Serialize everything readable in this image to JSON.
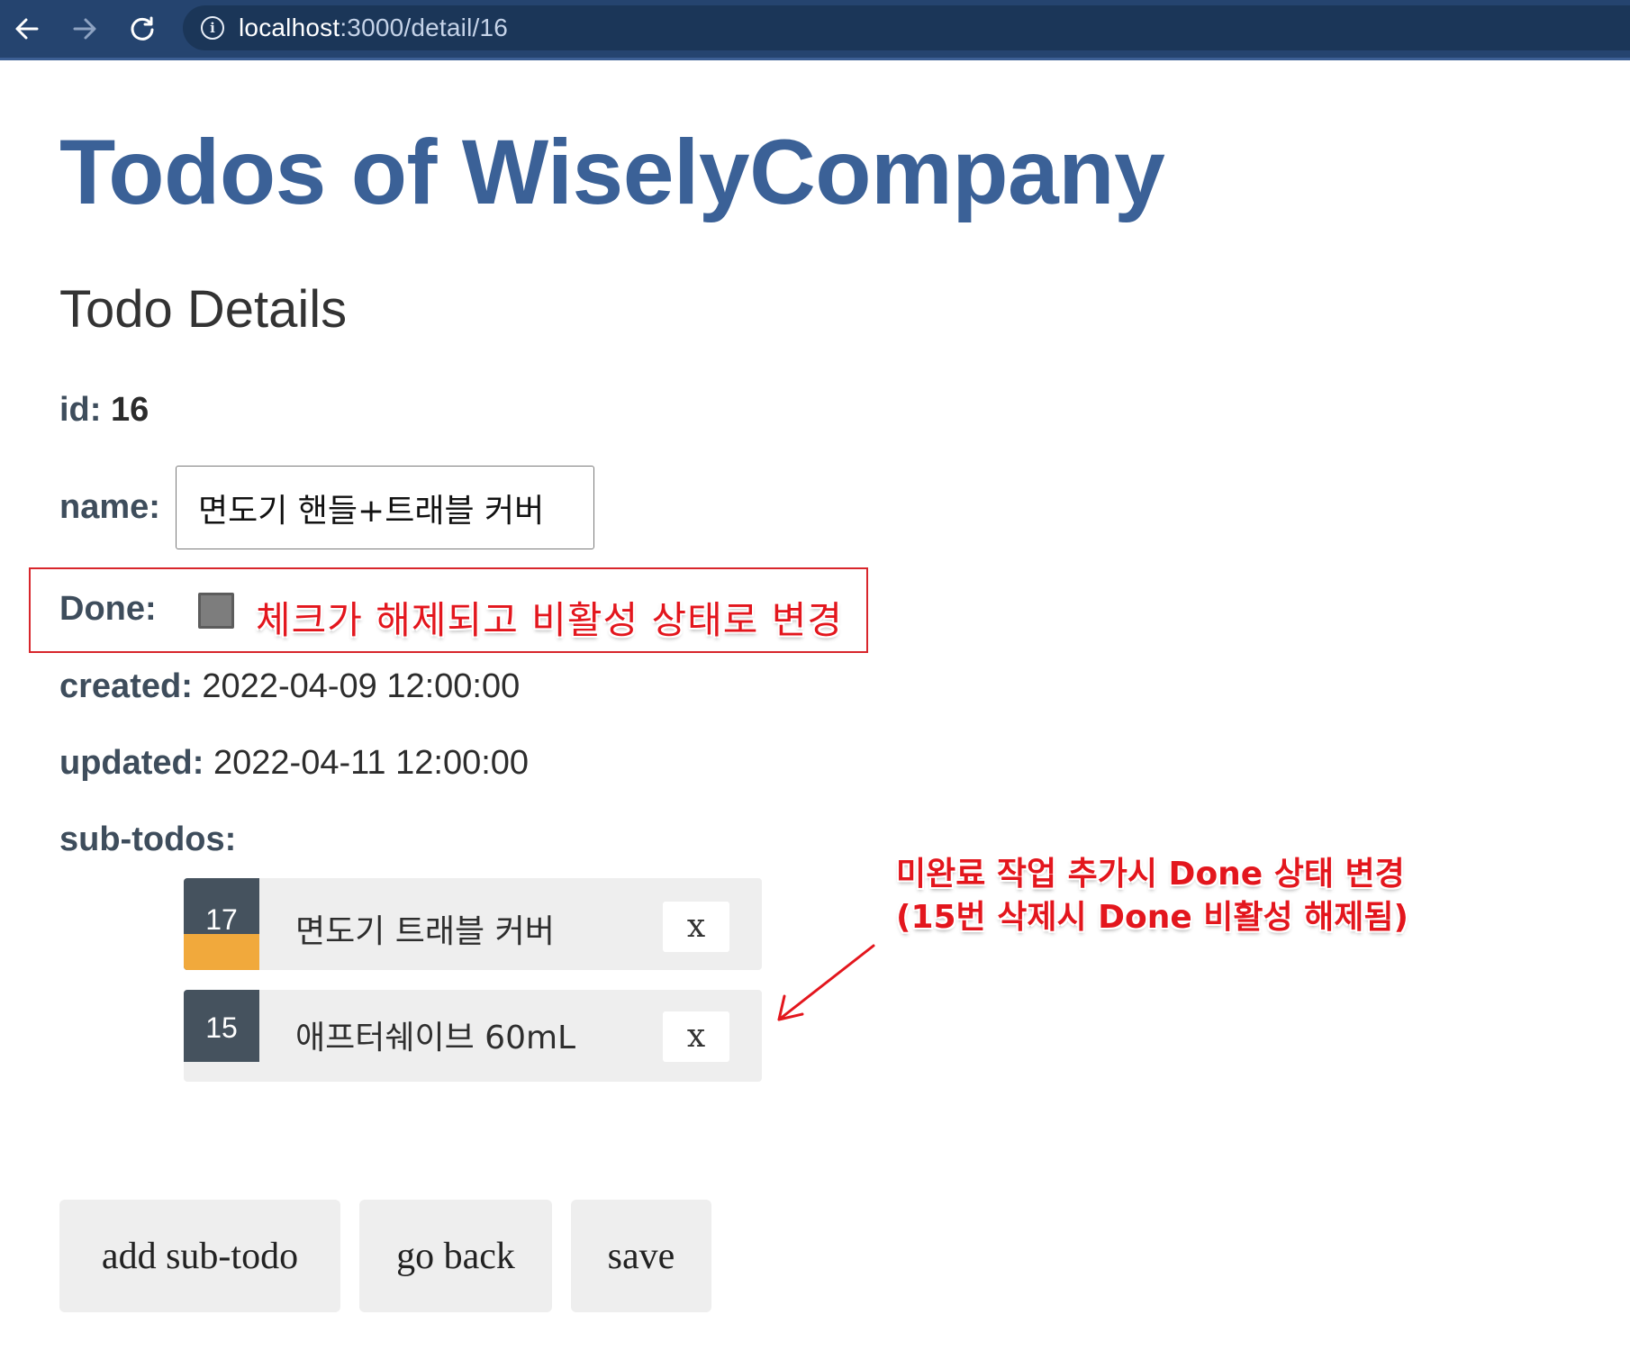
{
  "browser": {
    "url_host": "localhost",
    "url_path": ":3000/detail/16",
    "back_icon": "arrow-left",
    "forward_icon": "arrow-right",
    "reload_icon": "reload",
    "info_icon": "i"
  },
  "app": {
    "title": "Todos of WiselyCompany"
  },
  "detail": {
    "section_title": "Todo Details",
    "id_label": "id:",
    "id_value": "16",
    "name_label": "name:",
    "name_value": "면도기 핸들+트래블 커버",
    "done_label": "Done:",
    "done_checked": false,
    "created_label": "created:",
    "created_value": "2022-04-09 12:00:00",
    "updated_label": "updated:",
    "updated_value": "2022-04-11 12:00:00",
    "subtodos_label": "sub-todos:"
  },
  "subtodos": [
    {
      "id": "17",
      "name": "면도기 트래블 커버",
      "delete_label": "x",
      "progress_color": "#f1a93c"
    },
    {
      "id": "15",
      "name": "애프터쉐이브 60mL",
      "delete_label": "x"
    }
  ],
  "annotations": {
    "done_note": "체크가 해제되고 비활성 상태로 변경",
    "subtodo_note_line1": "미완료 작업 추가시 Done 상태 변경",
    "subtodo_note_line2": "(15번 삭제시 Done 비활성 해제됨)",
    "color": "#e3161d"
  },
  "buttons": {
    "add_subtodo": "add sub-todo",
    "go_back": "go back",
    "save": "save"
  },
  "colors": {
    "title": "#3b6197",
    "browser_bar": "#25446f",
    "badge": "#45525e",
    "button_bg": "#eeeeee"
  }
}
